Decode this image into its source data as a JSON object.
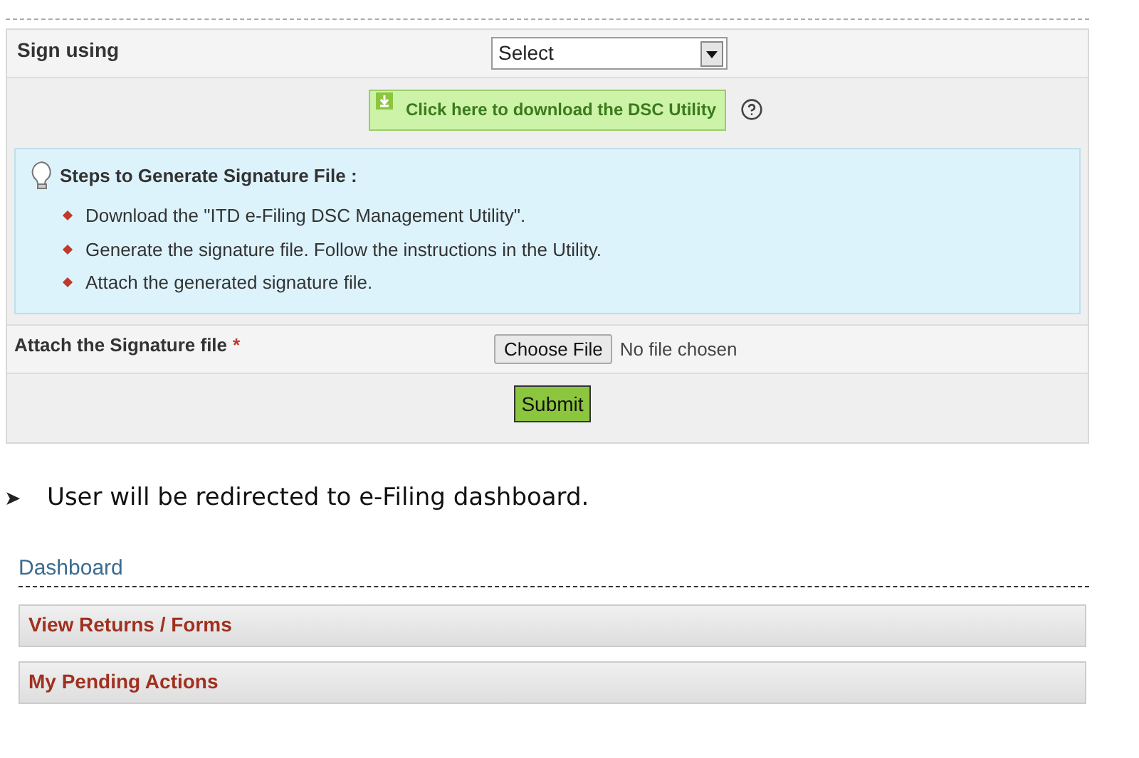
{
  "form": {
    "sign_using": {
      "label": "Sign using",
      "select_value": "Select"
    },
    "download": {
      "label": "Click here to download the DSC Utility"
    },
    "steps": {
      "title": "Steps to Generate Signature File :",
      "items": [
        "Download the \"ITD e-Filing DSC Management Utility\".",
        "Generate the signature file. Follow the instructions in the Utility.",
        "Attach the generated signature file."
      ]
    },
    "attach": {
      "label": "Attach the Signature file",
      "required_mark": "*",
      "button": "Choose File",
      "status": "No file chosen"
    },
    "submit": "Submit"
  },
  "note": {
    "marker": "➤",
    "text": "User will be redirected to e-Filing dashboard."
  },
  "dashboard": {
    "title": "Dashboard",
    "items": [
      "View Returns / Forms",
      "My Pending Actions"
    ]
  }
}
